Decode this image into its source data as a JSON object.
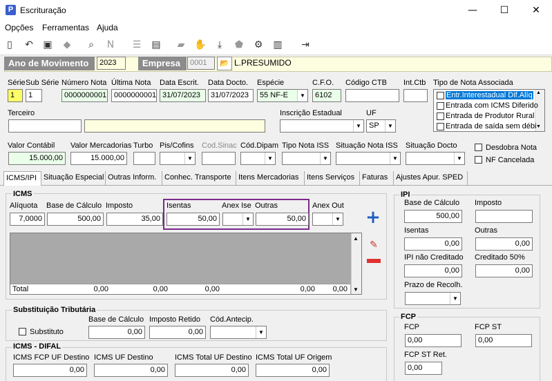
{
  "window": {
    "title": "Escrituração",
    "minimize": "—",
    "maximize": "☐",
    "close": "✕"
  },
  "menu": [
    "Opções",
    "Ferramentas",
    "Ajuda"
  ],
  "header": {
    "ano_label": "Ano de Movimento",
    "ano_value": "2023",
    "empresa_label": "Empresa",
    "empresa_code": "0001",
    "empresa_name": "L.PRESUMIDO"
  },
  "row1": {
    "serie_label": "Série",
    "serie": "1",
    "subserie_label": "Sub Série",
    "subserie": "1",
    "numero_label": "Número Nota",
    "numero": "0000000001",
    "ultima_label": "Última Nota",
    "ultima": "0000000001",
    "data_escrit_label": "Data Escrit.",
    "data_escrit": "31/07/2023",
    "data_docto_label": "Data Docto.",
    "data_docto": "31/07/2023",
    "especie_label": "Espécie",
    "especie": "55  NF-E",
    "cfo_label": "C.F.O.",
    "cfo": "6102",
    "codctb_label": "Código CTB",
    "codctb": "",
    "intctb_label": "Int.Ctb",
    "intctb": "",
    "tipo_label": "Tipo de Nota Associada",
    "tipos": [
      "Entr.Interestadual Dif.Alíq",
      "Entrada com ICMS Diferido",
      "Entrada de Produtor Rural",
      "Entrada de saída sem débi"
    ]
  },
  "row2": {
    "terceiro_label": "Terceiro",
    "terceiro_code": "",
    "terceiro_name": "",
    "ie_label": "Inscrição Estadual",
    "ie": "",
    "uf_label": "UF",
    "uf": "SP"
  },
  "row3": {
    "valor_contabil_label": "Valor Contábil",
    "valor_contabil": "15.000,00",
    "valor_merc_label": "Valor Mercadorias",
    "valor_merc": "15.000,00",
    "turbo_label": "Turbo",
    "pis_label": "Pis/Cofins",
    "codsinac_label": "Cod.Sinac",
    "coddipam_label": "Cód.Dipam",
    "tipoiss_label": "Tipo Nota ISS",
    "sitiss_label": "Situação Nota ISS",
    "sitdocto_label": "Situação Docto",
    "desdobra_label": "Desdobra Nota",
    "nfcanc_label": "NF Cancelada"
  },
  "tabs": [
    "ICMS/IPI",
    "Situação Especial",
    "Outras Inform.",
    "Conhec. Transporte",
    "Itens Mercadorias",
    "Itens Serviços",
    "Faturas",
    "Ajustes Apur. SPED"
  ],
  "icms": {
    "title": "ICMS",
    "aliquota_label": "Alíquota",
    "aliquota": "7,0000",
    "base_label": "Base de Cálculo",
    "base": "500,00",
    "imposto_label": "Imposto",
    "imposto": "35,00",
    "isentas_label": "Isentas",
    "isentas": "50,00",
    "anexise_label": "Anex Ise",
    "outras_label": "Outras",
    "outras": "50,00",
    "anexout_label": "Anex Out",
    "total_label": "Total",
    "totals": [
      "0,00",
      "0,00",
      "0,00",
      "0,00",
      "0,00"
    ]
  },
  "st": {
    "title": "Substituição Tributária",
    "substituto_label": "Substituto",
    "base_label": "Base de Cálculo",
    "base": "0,00",
    "retido_label": "Imposto Retido",
    "retido": "0,00",
    "cod_label": "Cód.Antecip."
  },
  "difal": {
    "title": "ICMS - DIFAL",
    "fcp_label": "ICMS FCP UF Destino",
    "fcp": "0,00",
    "uf_dest_label": "ICMS UF Destino",
    "uf_dest": "0,00",
    "total_dest_label": "ICMS Total UF Destino",
    "total_dest": "0,00",
    "total_orig_label": "ICMS Total UF Origem",
    "total_orig": "0,00"
  },
  "ipi": {
    "title": "IPI",
    "base_label": "Base de Cálculo",
    "base": "500,00",
    "imposto_label": "Imposto",
    "imposto": "",
    "isentas_label": "Isentas",
    "isentas": "0,00",
    "outras_label": "Outras",
    "outras": "0,00",
    "nao_cred_label": "IPI não Creditado",
    "nao_cred": "0,00",
    "cred50_label": "Creditado 50%",
    "cred50": "0,00",
    "prazo_label": "Prazo de Recolh."
  },
  "fcp": {
    "title": "FCP",
    "fcp_label": "FCP",
    "fcp": "0,00",
    "fcpst_label": "FCP ST",
    "fcpst": "0,00",
    "fcpstret_label": "FCP ST Ret.",
    "fcpstret": "0,00"
  }
}
